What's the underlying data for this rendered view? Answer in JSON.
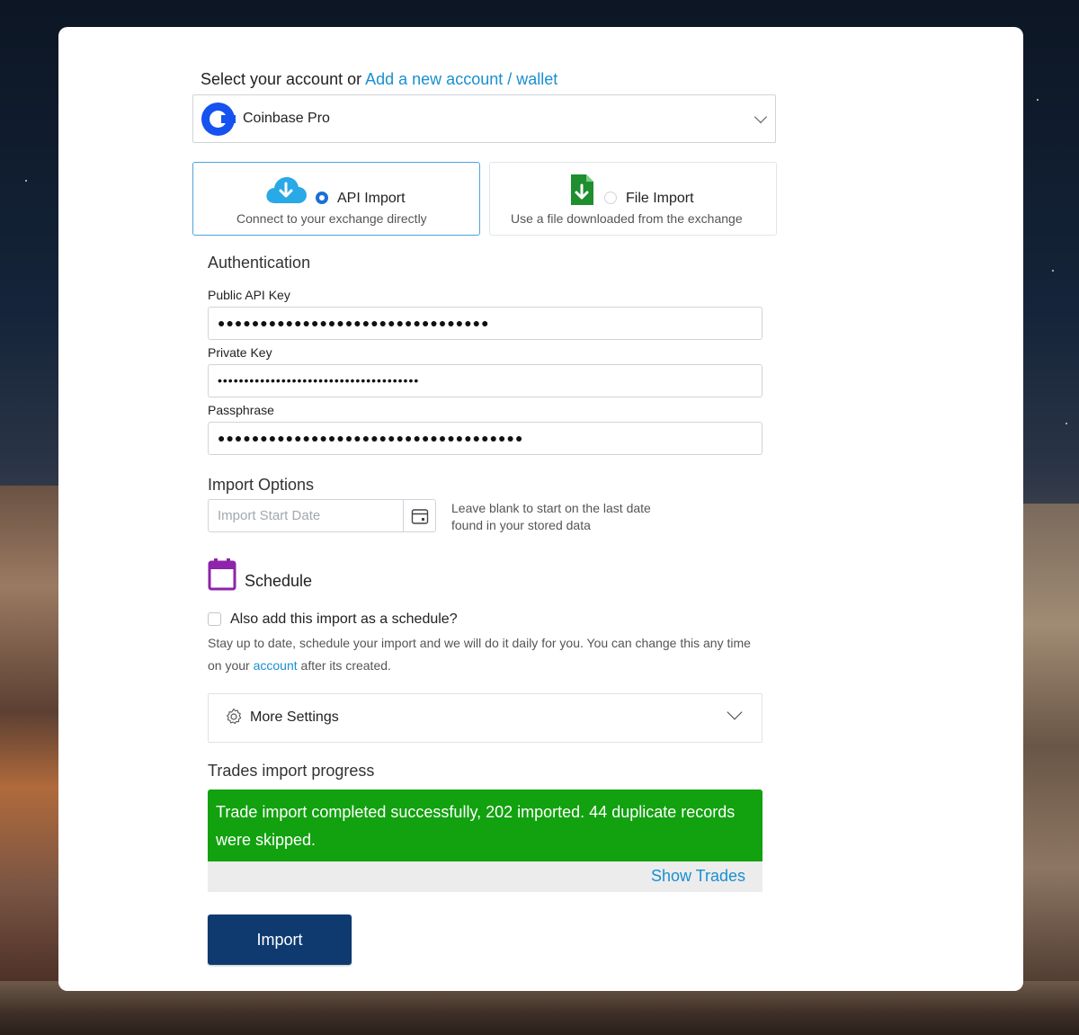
{
  "account_select": {
    "label_prefix": "Select your account or",
    "add_link": "Add a new account / wallet",
    "selected": "Coinbase Pro"
  },
  "import_modes": {
    "api": {
      "title": "API Import",
      "subtitle": "Connect to your exchange directly",
      "selected": true
    },
    "file": {
      "title": "File Import",
      "subtitle": "Use a file downloaded from the exchange",
      "selected": false
    }
  },
  "authentication": {
    "heading": "Authentication",
    "public_key": {
      "label": "Public API Key",
      "value": "●●●●●●●●●●●●●●●●●●●●●●●●●●●●●●●●"
    },
    "private_key": {
      "label": "Private Key",
      "value": "••••••••••••••••••••••••••••••••••••••"
    },
    "passphrase": {
      "label": "Passphrase",
      "value": "●●●●●●●●●●●●●●●●●●●●●●●●●●●●●●●●●●●●"
    }
  },
  "import_options": {
    "heading": "Import Options",
    "start_date_placeholder": "Import Start Date",
    "hint": "Leave blank to start on the last date found in your stored data"
  },
  "schedule": {
    "heading": "Schedule",
    "checkbox_label": "Also add this import as a schedule?",
    "checked": false,
    "desc_before": "Stay up to date, schedule your import and we will do it daily for you. You can change this any time on your ",
    "desc_link": "account",
    "desc_after": " after its created."
  },
  "more_settings": {
    "label": "More Settings"
  },
  "progress": {
    "heading": "Trades import progress",
    "message": "Trade import completed successfully, 202 imported. 44 duplicate records were skipped.",
    "show_trades": "Show Trades"
  },
  "import_button": "Import",
  "colors": {
    "link": "#1a8fd1",
    "success": "#12a10f",
    "primary_button": "#0e3a70",
    "schedule_icon": "#8e24aa",
    "file_icon": "#1e8e2e",
    "cloud_icon": "#29a9e6"
  }
}
